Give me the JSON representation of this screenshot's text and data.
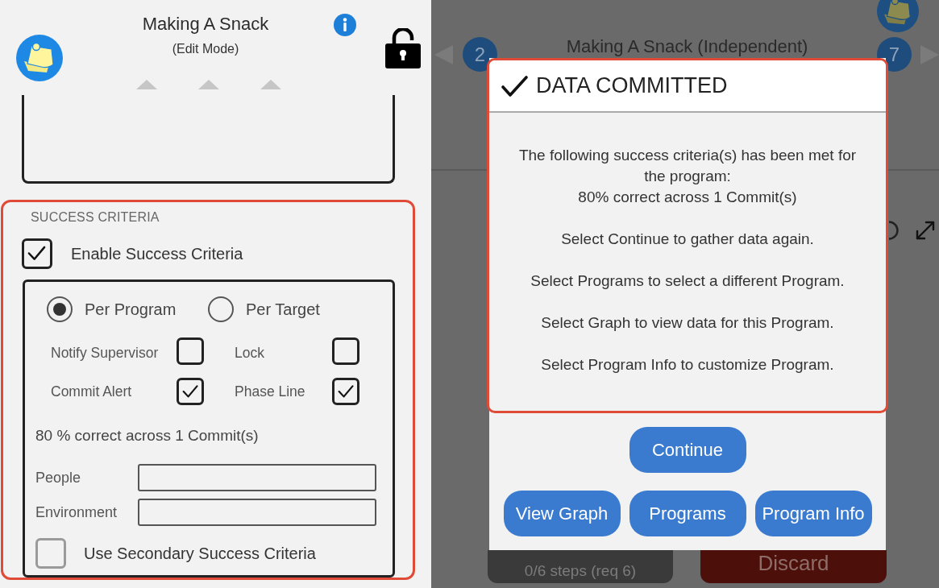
{
  "left_screen": {
    "title": "Making A Snack",
    "subtitle": "(Edit Mode)",
    "success_criteria": {
      "highlighted": true,
      "heading": "SUCCESS CRITERIA",
      "enable": {
        "label": "Enable Success Criteria",
        "checked": true
      },
      "scope_options": [
        {
          "label": "Per Program",
          "selected": true
        },
        {
          "label": "Per Target",
          "selected": false
        }
      ],
      "options": [
        {
          "label": "Notify Supervisor",
          "checked": false
        },
        {
          "label": "Lock",
          "checked": false
        },
        {
          "label": "Commit Alert",
          "checked": true
        },
        {
          "label": "Phase Line",
          "checked": true
        }
      ],
      "summary": "80 % correct across 1 Commit(s)",
      "fields": [
        {
          "label": "People"
        },
        {
          "label": "Environment"
        }
      ],
      "secondary": {
        "label": "Use Secondary Success Criteria",
        "checked": false
      }
    }
  },
  "right_screen": {
    "prev_badge": "2",
    "program_title": "Making A Snack (Independent)",
    "next_badge": "7",
    "steps_button": "0/6 steps (req 6)",
    "discard_button": "Discard",
    "dialog": {
      "highlighted": true,
      "title": "DATA COMMITTED",
      "message_blocks": [
        [
          "The following success criteria(s) has been met for the program:",
          "80% correct across 1 Commit(s)"
        ],
        [
          "Select Continue to gather data again."
        ],
        [
          "Select Programs to select a different Program."
        ],
        [
          "Select Graph to view data for this Program."
        ],
        [
          "Select Program Info to customize Program."
        ]
      ],
      "button_rows": [
        [
          "Continue"
        ],
        [
          "View Graph",
          "Programs",
          "Program Info"
        ]
      ]
    }
  }
}
